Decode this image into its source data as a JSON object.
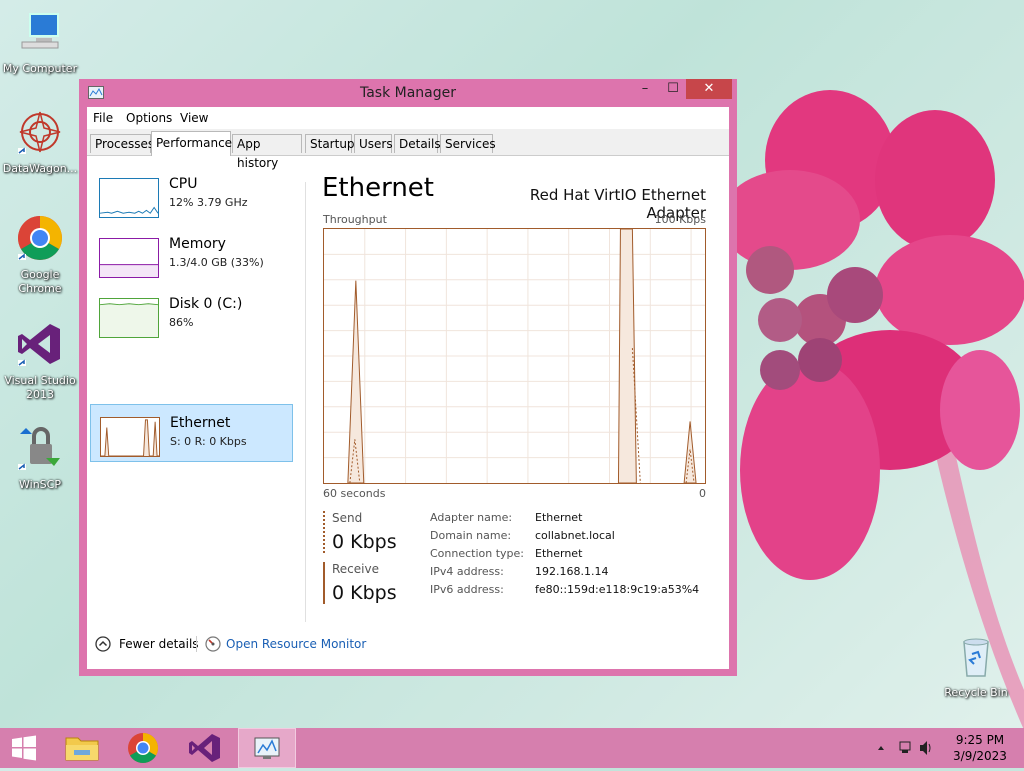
{
  "desktop": {
    "icons": [
      {
        "label": "My Computer"
      },
      {
        "label": "DataWagon..."
      },
      {
        "label": "Google Chrome"
      },
      {
        "label": "Visual Studio 2013"
      },
      {
        "label": "WinSCP"
      },
      {
        "label": "Recycle Bin"
      }
    ]
  },
  "window": {
    "title": "Task Manager",
    "controls": {
      "minimize": "–",
      "maximize": "☐",
      "close": "✕"
    },
    "menu": [
      "File",
      "Options",
      "View"
    ],
    "tabs": [
      "Processes",
      "Performance",
      "App history",
      "Startup",
      "Users",
      "Details",
      "Services"
    ],
    "active_tab": "Performance"
  },
  "sidebar": {
    "items": [
      {
        "title": "CPU",
        "sub": "12%  3.79 GHz",
        "color": "#1c7ab5"
      },
      {
        "title": "Memory",
        "sub": "1.3/4.0 GB (33%)",
        "color": "#8b1aa6"
      },
      {
        "title": "Disk 0 (C:)",
        "sub": "86%",
        "color": "#4fa53a"
      },
      {
        "title": "Ethernet",
        "sub": "S: 0  R: 0 Kbps",
        "color": "#a15b2b"
      }
    ]
  },
  "main": {
    "title": "Ethernet",
    "adapter": "Red Hat VirtIO Ethernet Adapter",
    "graph": {
      "y_label": "Throughput",
      "y_max_label": "100 Kbps",
      "x_left_label": "60 seconds",
      "x_right_label": "0"
    },
    "send": {
      "label": "Send",
      "value": "0 Kbps"
    },
    "receive": {
      "label": "Receive",
      "value": "0 Kbps"
    },
    "info": [
      {
        "label": "Adapter name:",
        "value": "Ethernet"
      },
      {
        "label": "Domain name:",
        "value": "collabnet.local"
      },
      {
        "label": "Connection type:",
        "value": "Ethernet"
      },
      {
        "label": "IPv4 address:",
        "value": "192.168.1.14"
      },
      {
        "label": "IPv6 address:",
        "value": "fe80::159d:e118:9c19:a53%4"
      }
    ]
  },
  "footer": {
    "fewer_details": "Fewer details",
    "open_resmon": "Open Resource Monitor"
  },
  "taskbar": {
    "time": "9:25 PM",
    "date": "3/9/2023"
  }
}
